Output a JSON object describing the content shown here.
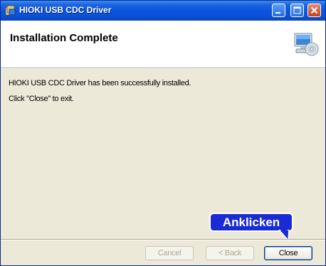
{
  "window": {
    "title": "HIOKI USB CDC Driver"
  },
  "header": {
    "title": "Installation Complete"
  },
  "body": {
    "line1": "HIOKI USB CDC Driver has been successfully installed.",
    "line2": "Click \"Close\" to exit."
  },
  "buttons": {
    "cancel": "Cancel",
    "back": "< Back",
    "close": "Close"
  },
  "callout": {
    "label": "Anklicken",
    "color": "#1a2bd6"
  },
  "colors": {
    "titlebar": "#0a50d6",
    "dialog_bg": "#ece9d8",
    "close_button": "#c4401d"
  }
}
